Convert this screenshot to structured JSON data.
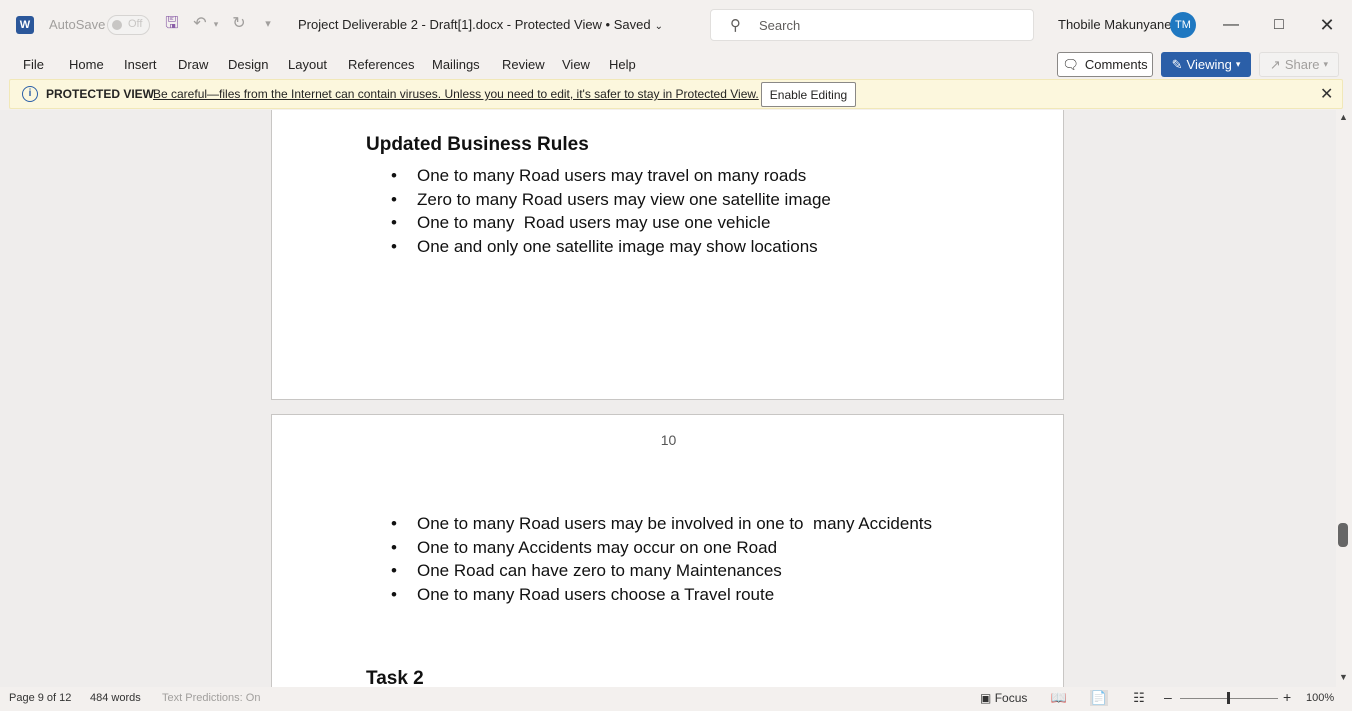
{
  "titlebar": {
    "app_logo": "W",
    "autosave_label": "AutoSave",
    "autosave_state": "Off",
    "document_title": "Project Deliverable 2 - Draft[1].docx  -  Protected View • Saved",
    "search_placeholder": "Search",
    "user_name": "Thobile Makunyane",
    "user_initials": "TM",
    "icons": [
      "word-logo",
      "save-icon",
      "undo-icon",
      "redo-icon",
      "customize-qat-icon",
      "search-icon",
      "minimize-icon",
      "maximize-icon",
      "close-icon"
    ]
  },
  "ribbon": {
    "tabs": [
      "File",
      "Home",
      "Insert",
      "Draw",
      "Design",
      "Layout",
      "References",
      "Mailings",
      "Review",
      "View",
      "Help"
    ],
    "comments_label": "Comments",
    "viewing_label": "Viewing",
    "share_label": "Share",
    "accent_color": "#2b5fa8"
  },
  "protected_view": {
    "title": "PROTECTED VIEW",
    "message": "Be careful—files from the Internet can contain viruses. Unless you need to edit, it's safer to stay in Protected View.",
    "enable_button": "Enable Editing",
    "bar_color": "#fcf7dd"
  },
  "document": {
    "page1": {
      "heading": "Updated Business Rules",
      "bullets": [
        "One to many Road users may travel on many roads",
        "Zero to many Road users may view one satellite image",
        "One to many  Road users may use one vehicle",
        "One and only one satellite image may show locations"
      ]
    },
    "page2": {
      "page_number": "10",
      "bullets": [
        "One to many Road users may be involved in one to  many Accidents",
        "One to many Accidents may occur on one Road",
        "One Road can have zero to many Maintenances",
        "One to many Road users choose a Travel route"
      ],
      "heading": "Task 2"
    }
  },
  "statusbar": {
    "page_info": "Page 9 of 12",
    "word_count": "484 words",
    "text_predictions": "Text Predictions: On",
    "focus_label": "Focus",
    "zoom_level": "100%"
  }
}
